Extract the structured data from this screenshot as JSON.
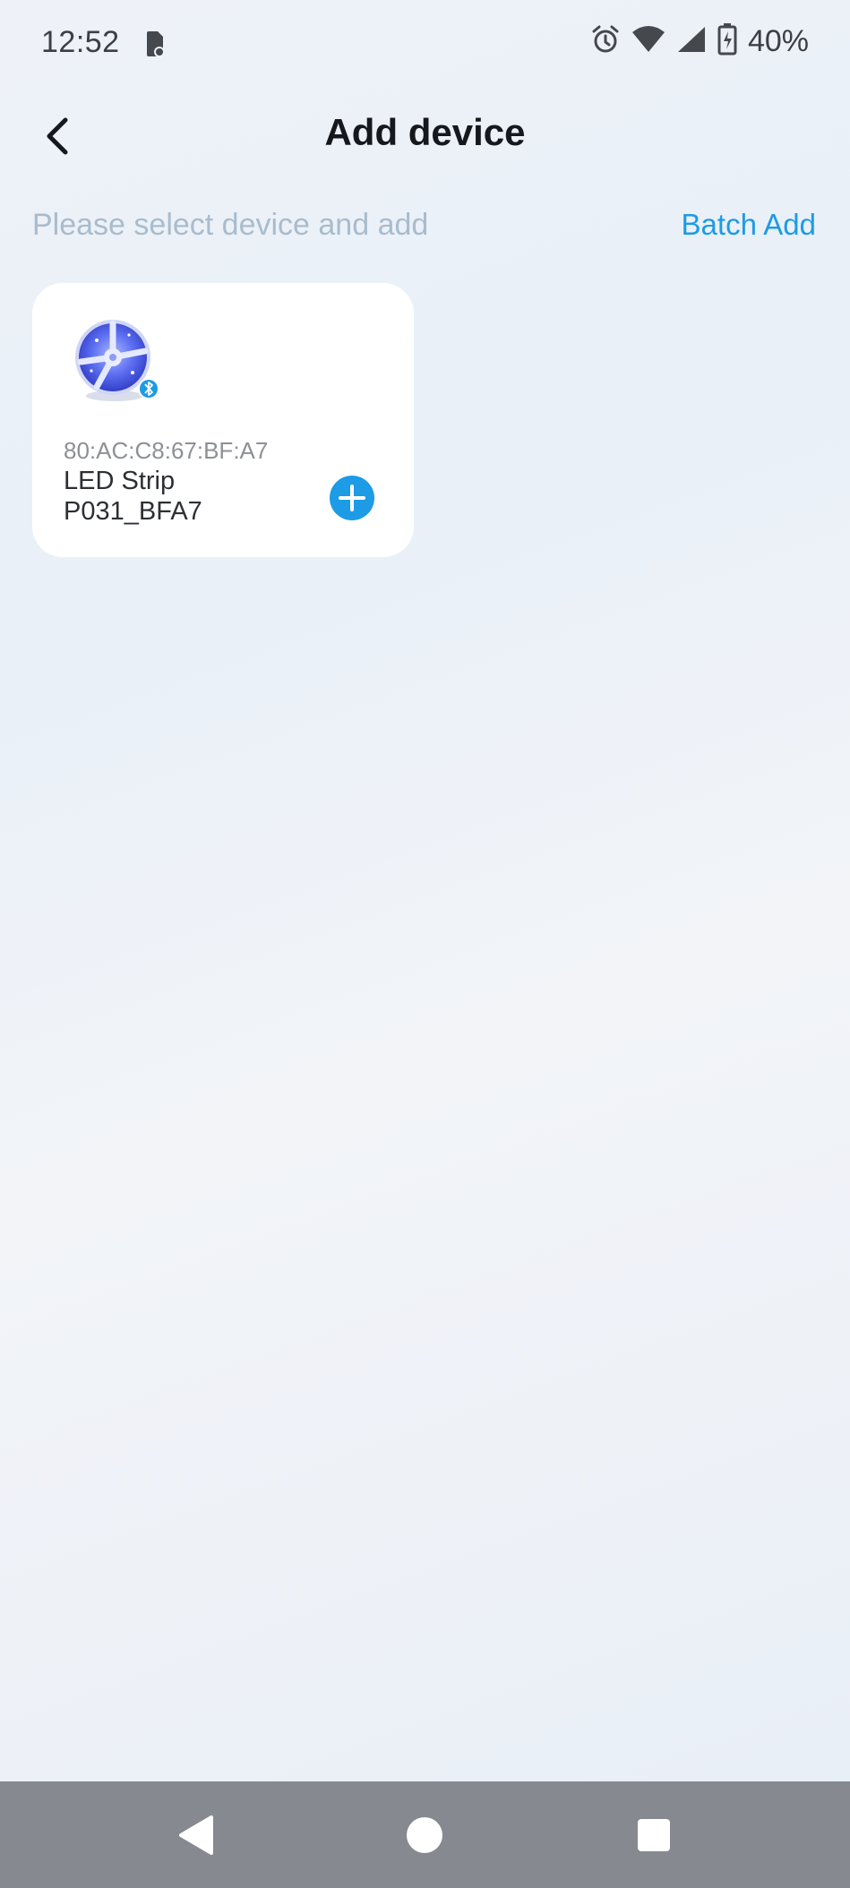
{
  "status_bar": {
    "time": "12:52",
    "battery_percent": "40%",
    "icons": [
      "battery-saver-icon",
      "alarm-icon",
      "wifi-icon",
      "cellular-signal-icon",
      "battery-charging-icon"
    ]
  },
  "header": {
    "title": "Add device",
    "back_icon": "chevron-left-icon"
  },
  "instruction": "Please select device and add",
  "batch_add_label": "Batch Add",
  "devices": [
    {
      "mac": "80:AC:C8:67:BF:A7",
      "name": "LED Strip P031_BFA7",
      "image_icon": "led-strip-reel-icon",
      "badge_icon": "bluetooth-icon",
      "add_icon": "plus-circle-icon"
    }
  ],
  "nav_bar": {
    "buttons": [
      "back-triangle-icon",
      "home-circle-icon",
      "recents-square-icon"
    ]
  },
  "colors": {
    "accent": "#1d9be5",
    "title": "#15181c",
    "subtitle": "#a9bccd",
    "nav_bar": "#878991",
    "card": "#ffffff"
  }
}
